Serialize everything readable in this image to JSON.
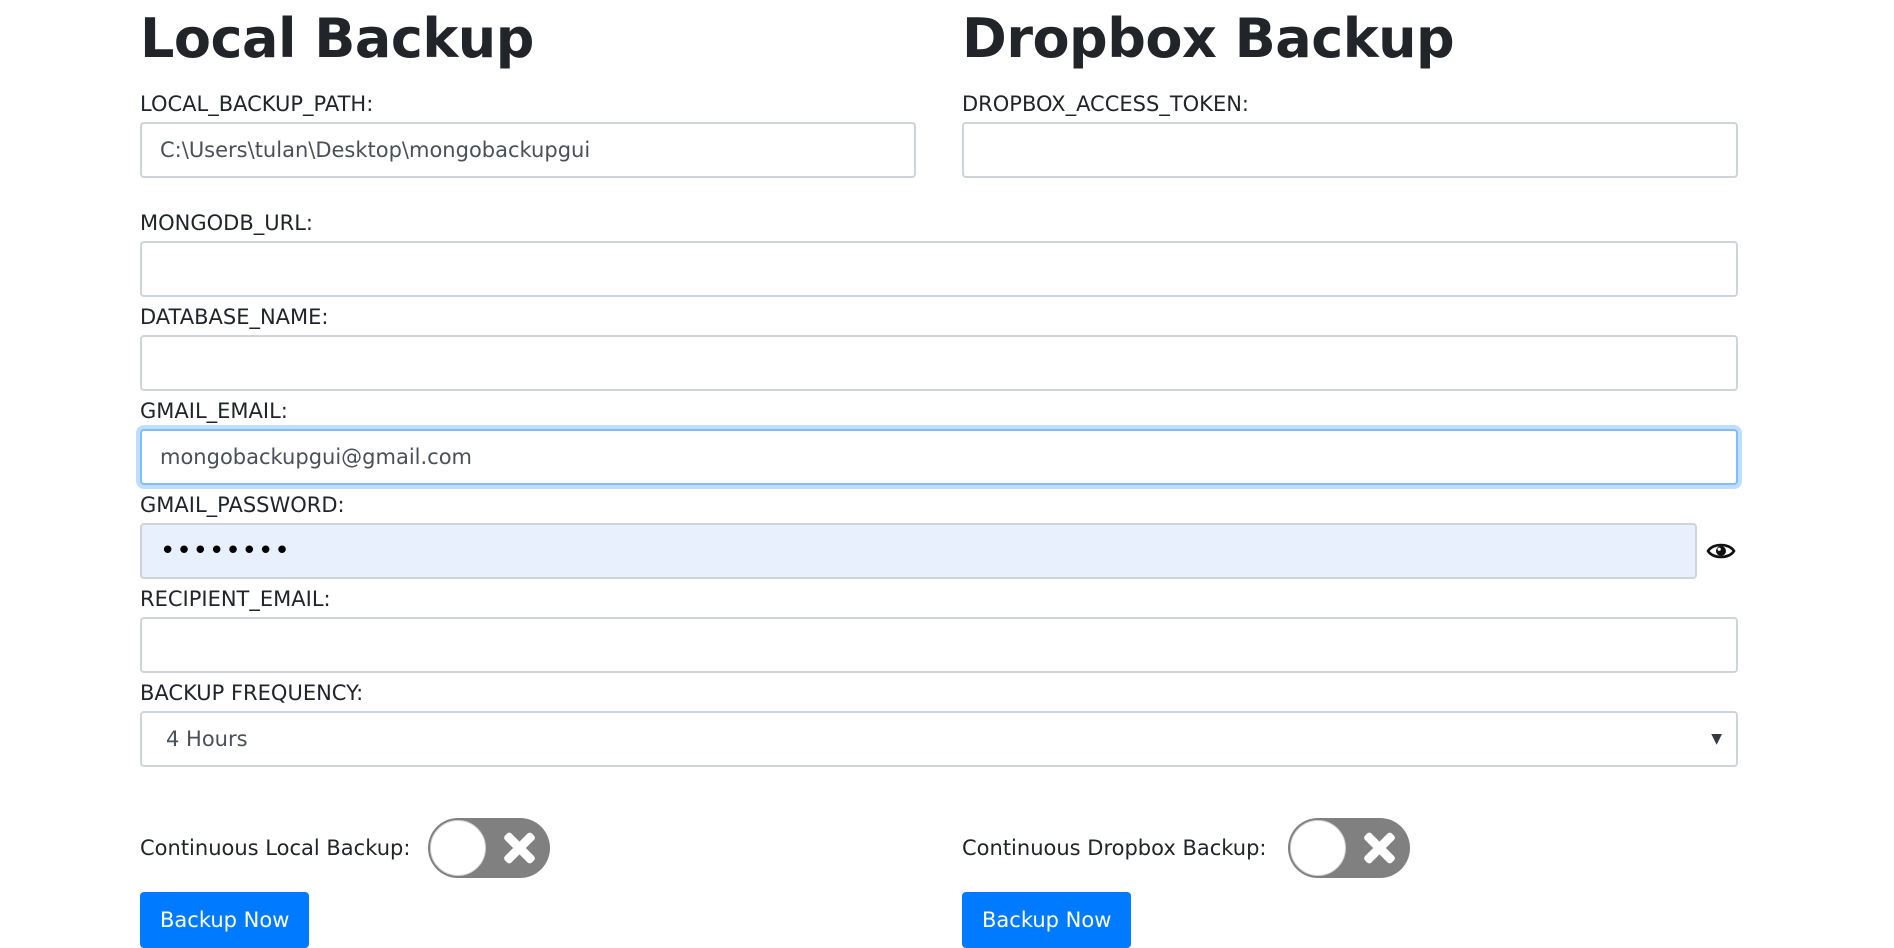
{
  "local": {
    "heading": "Local Backup",
    "path_label": "LOCAL_BACKUP_PATH:",
    "path_value": "C:\\Users\\tulan\\Desktop\\mongobackupgui",
    "continuous_label": "Continuous Local Backup:",
    "continuous_enabled": false,
    "backup_button": "Backup Now"
  },
  "dropbox": {
    "heading": "Dropbox Backup",
    "token_label": "DROPBOX_ACCESS_TOKEN:",
    "token_value": "",
    "continuous_label": "Continuous Dropbox Backup:",
    "continuous_enabled": false,
    "backup_button": "Backup Now"
  },
  "form": {
    "mongodb_url_label": "MONGODB_URL:",
    "mongodb_url_value": "",
    "database_name_label": "DATABASE_NAME:",
    "database_name_value": "",
    "gmail_email_label": "GMAIL_EMAIL:",
    "gmail_email_value": "mongobackupgui@gmail.com",
    "gmail_password_label": "GMAIL_PASSWORD:",
    "gmail_password_masked": "••••••••",
    "recipient_email_label": "RECIPIENT_EMAIL:",
    "recipient_email_value": "",
    "frequency_label": "BACKUP FREQUENCY:",
    "frequency_selected": "4 Hours"
  },
  "icons": {
    "password_toggle": "eye-icon",
    "select_arrow": "caret-down-icon",
    "toggle_off": "x-icon"
  },
  "colors": {
    "primary": "#007bff",
    "toggle_off": "#808080",
    "autofill_bg": "#e8f0fe",
    "focus_border": "#80bdff"
  }
}
